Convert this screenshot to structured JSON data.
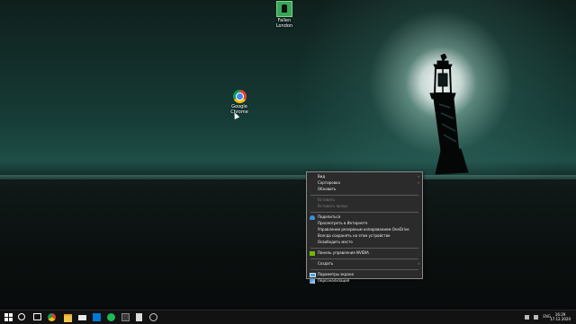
{
  "desktop": {
    "icons": [
      {
        "label_line1": "Fallen",
        "label_line2": "London"
      },
      {
        "label_line1": "Google",
        "label_line2": "Chrome"
      }
    ]
  },
  "context_menu": {
    "items": [
      {
        "label": "Вид",
        "has_submenu": true,
        "disabled": false
      },
      {
        "label": "Сортировка",
        "has_submenu": true,
        "disabled": false
      },
      {
        "label": "Обновить",
        "has_submenu": false,
        "disabled": false
      },
      {
        "label": "Вставить",
        "has_submenu": false,
        "disabled": true
      },
      {
        "label": "Вставить ярлык",
        "has_submenu": false,
        "disabled": true
      },
      {
        "label": "Поделиться",
        "icon": "onedrive-cloud-icon"
      },
      {
        "label": "Просмотреть в Интернете"
      },
      {
        "label": "Управление резервным копированием OneDrive"
      },
      {
        "label": "Всегда сохранять на этом устройстве"
      },
      {
        "label": "Освободить место"
      },
      {
        "label": "Панель управления NVIDIA",
        "icon": "nvidia-icon"
      },
      {
        "label": "Создать",
        "has_submenu": true
      },
      {
        "label": "Параметры экрана",
        "icon": "display-settings-icon"
      },
      {
        "label": "Персонализация",
        "icon": "personalization-icon"
      }
    ]
  },
  "taskbar": {
    "tray_language": "ENG",
    "clock_time": "16:29",
    "clock_date": "17.12.2020"
  },
  "colors": {
    "menu_bg": "#2b2b2b",
    "menu_border": "#8a8a8a",
    "taskbar_bg": "#121212",
    "wallpaper_teal": "#1e4e47"
  }
}
